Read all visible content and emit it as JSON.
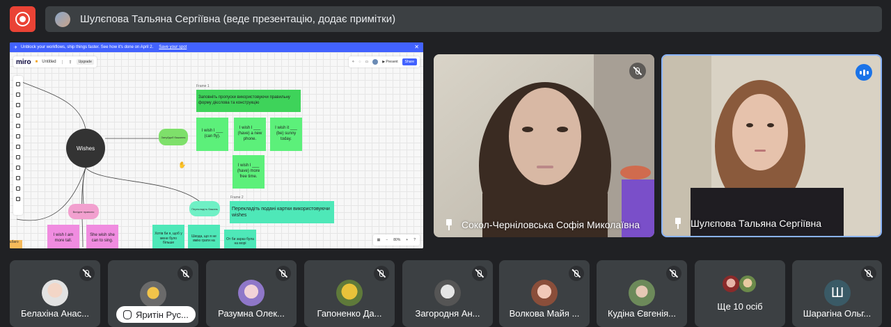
{
  "top_bar": {
    "presenter_label": "Шулєпова Тальяна Сергіївна (веде презентацію, додає примітки)"
  },
  "screen_share": {
    "banner_text": "Unblock your workflows, ship things faster. See how it's done on April 2.",
    "banner_link": "Save your spot",
    "banner_close": "✕",
    "board": {
      "logo": "miro",
      "board_name": "Untitled",
      "upgrade_label": "Upgrade",
      "present_label": "▶ Present",
      "share_label": "Share",
      "zoom_level": "80%",
      "zoom_minus": "−",
      "zoom_plus": "+",
      "help": "?"
    },
    "center_node": "Wishes",
    "pills": {
      "green_top": "Зануйдоб бажання",
      "pink": "Вигідне правило",
      "green_bottom": "Перекладіть бажань"
    },
    "frame1": {
      "label": "Frame 1",
      "header": "Заповніть пропуски використовуючи правильну форму дієслова та конструкцію",
      "notes": [
        "I wish I ___ (can fly).",
        "I wish I ___ (have) a new phone.",
        "I wish it ___ (be) sunny today.",
        "I wish I ___ (have) more free time."
      ]
    },
    "frame2": {
      "label": "Frame 2",
      "header": "Перекладіть подані картки використовуючи wishes",
      "notes": [
        "Хотів би я, щоб у мене було більше",
        "Шкода, що я не вмію грати на",
        "От би зараз була на морі"
      ]
    },
    "pink_notes": [
      "I wish I am more tall.",
      "She wish she can to sing."
    ],
    "edge_label": "ьбаго"
  },
  "participants_main": [
    {
      "name": "Сокол-Черніловська Софія Миколаївна",
      "muted": true
    },
    {
      "name": "Шулєпова Тальяна Сергіївна",
      "speaking": true
    }
  ],
  "participants_strip": [
    {
      "name": "Белахіна Анас..."
    },
    {
      "name": "Яритін Рус...",
      "hand_raised": true
    },
    {
      "name": "Разумна Олек..."
    },
    {
      "name": "Гапоненко Да..."
    },
    {
      "name": "Загородня Ан..."
    },
    {
      "name": "Волкова Майя ..."
    },
    {
      "name": "Кудіна Євгенія..."
    },
    {
      "name": "Ще 10 осіб"
    },
    {
      "name": "Шарагіна Ольг...",
      "initial": "Ш"
    }
  ],
  "colors": {
    "record": "#ea4335",
    "bar": "#3c4043",
    "miro_blue": "#4262ff",
    "sticky_green": "#5cf07a",
    "sticky_teal": "#4ee8b8",
    "sticky_pink": "#f08ce0",
    "speaking_blue": "#1a73e8"
  }
}
